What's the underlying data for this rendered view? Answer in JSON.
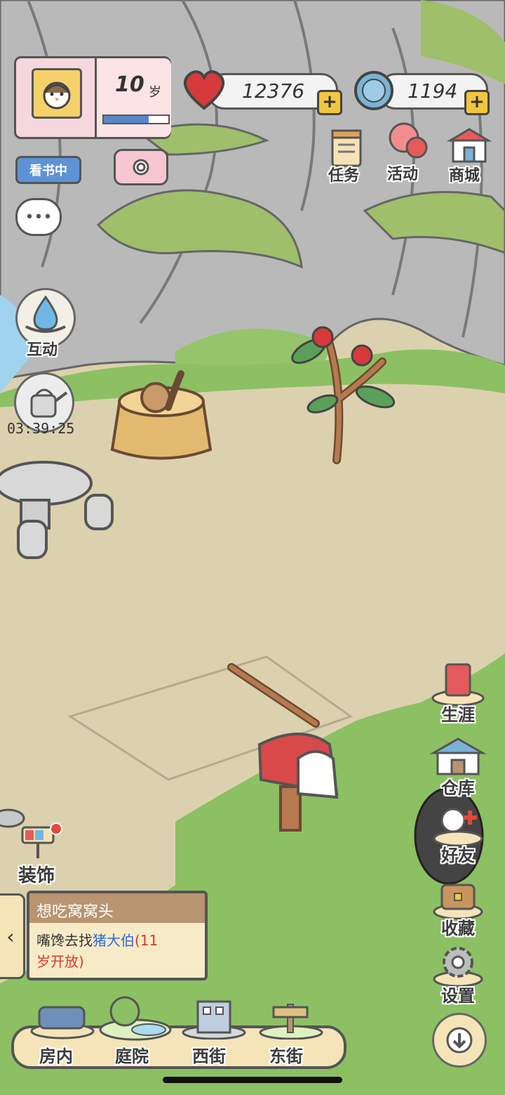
{
  "profile": {
    "age_value": "10",
    "age_unit": "岁",
    "age_progress": 0.7
  },
  "status_tag": "看书中",
  "currency": {
    "hearts": "12376",
    "clovers": "1194",
    "add_symbol": "+"
  },
  "top_menu": [
    {
      "label": "任务",
      "icon": "task-notepad-icon"
    },
    {
      "label": "活动",
      "icon": "balloon-icon"
    },
    {
      "label": "商城",
      "icon": "shop-icon"
    }
  ],
  "left_actions": {
    "interact_label": "互动",
    "watering_timer": "03:39:25"
  },
  "decorate_label": "装饰",
  "quest": {
    "title": "想吃窝窝头",
    "line1_prefix": "嘴馋去找",
    "npc_name": "猪大伯",
    "line1_suffix": "(11",
    "line2": "岁开放)"
  },
  "right_menu": [
    {
      "label": "生涯"
    },
    {
      "label": "仓库"
    },
    {
      "label": "好友"
    },
    {
      "label": "收藏"
    },
    {
      "label": "设置"
    }
  ],
  "bottom_nav": [
    {
      "label": "房内"
    },
    {
      "label": "庭院"
    },
    {
      "label": "西街"
    },
    {
      "label": "东街"
    }
  ],
  "colors": {
    "heart": "#d63a3a",
    "clover": "#7ab3d6",
    "npc_name": "#2d6bd6",
    "unlock_note": "#d93a2a",
    "grass": "#8cc063",
    "ground": "#dcd1ae",
    "rock": "#b8b8b8"
  }
}
